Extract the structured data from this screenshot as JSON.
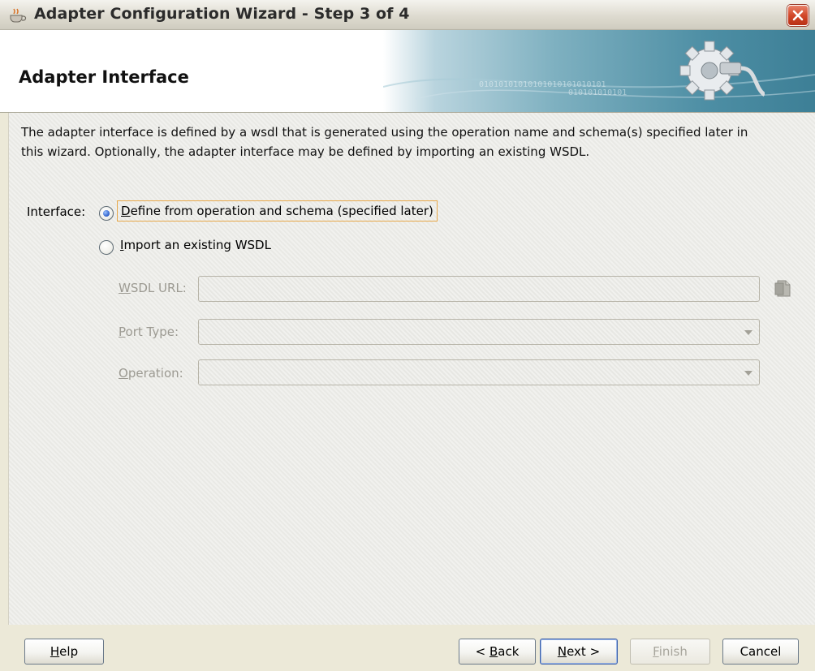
{
  "window": {
    "title": "Adapter Configuration Wizard - Step 3 of 4"
  },
  "header": {
    "title": "Adapter Interface",
    "banner_text": [
      "01010101010101010101010101",
      "010101010101"
    ]
  },
  "description": {
    "line1": "The adapter interface is defined by a wsdl that is generated using the operation name and schema(s) specified later in",
    "line2": "this wizard.  Optionally, the adapter interface may be defined by importing an existing WSDL."
  },
  "interface": {
    "label": "Interface:",
    "option1": {
      "mnemonic": "D",
      "rest": "efine from operation and schema (specified later)",
      "selected": true
    },
    "option2": {
      "mnemonic": "I",
      "rest": "mport an existing WSDL",
      "selected": false
    }
  },
  "fields": {
    "wsdl_url": {
      "mnemonic": "W",
      "rest": "SDL URL:",
      "value": ""
    },
    "port_type": {
      "mnemonic": "P",
      "rest": "ort Type:",
      "value": ""
    },
    "operation": {
      "mnemonic": "O",
      "rest": "peration:",
      "value": ""
    }
  },
  "buttons": {
    "help": {
      "mnemonic": "H",
      "rest": "elp"
    },
    "back": {
      "pre": "< ",
      "mnemonic": "B",
      "rest": "ack"
    },
    "next": {
      "mnemonic": "N",
      "rest": "ext >"
    },
    "finish": {
      "mnemonic": "F",
      "rest": "inish"
    },
    "cancel": {
      "label": "Cancel"
    }
  },
  "colors": {
    "focus_border": "#e7a84a",
    "default_button_border": "#3a5ea8",
    "disabled_text": "#9c9a92"
  }
}
